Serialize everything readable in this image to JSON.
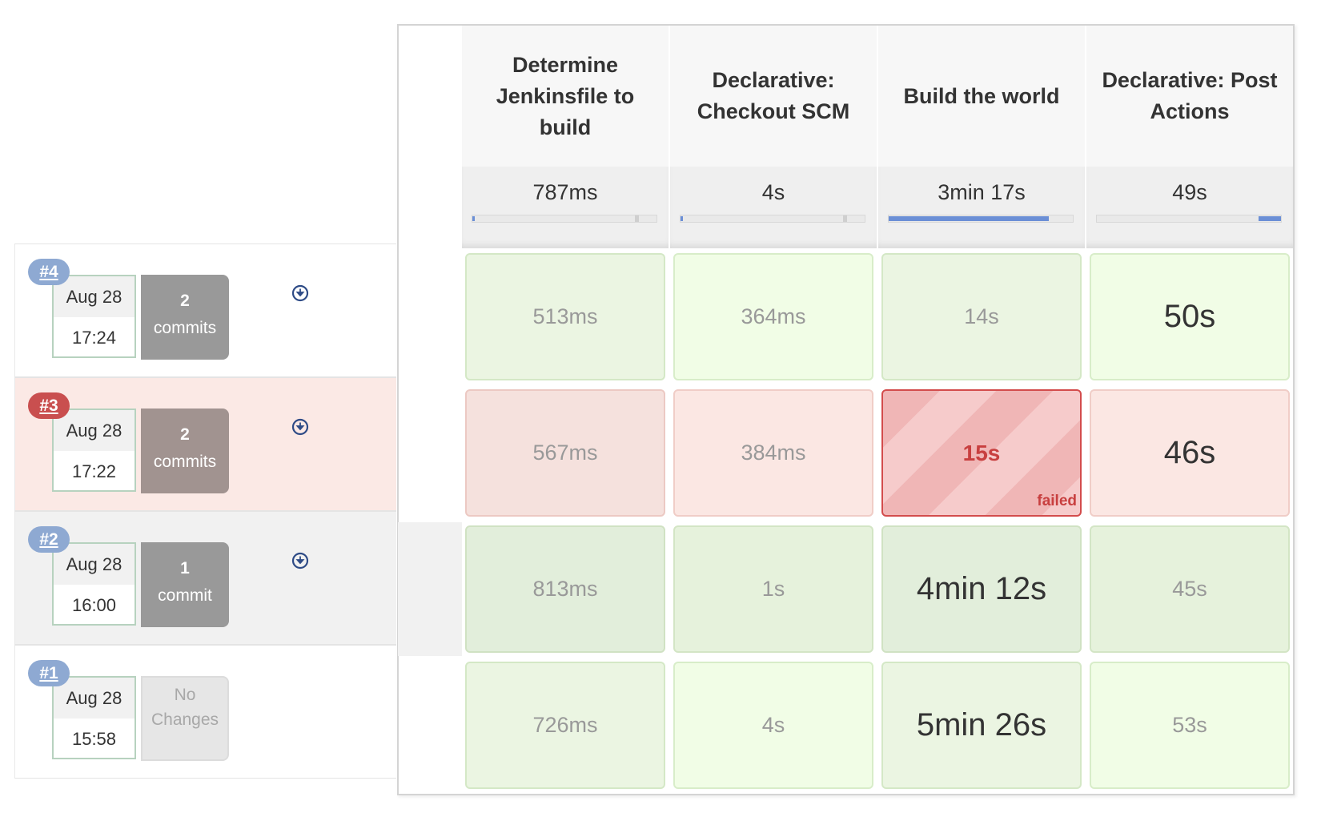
{
  "stages": [
    {
      "name": "Determine Jenkinsfile to build",
      "avg": "787ms",
      "bar": {
        "start": 0.0,
        "end": 0.01
      }
    },
    {
      "name": "Declarative: Checkout SCM",
      "avg": "4s",
      "bar": {
        "start": 0.0,
        "end": 0.01
      }
    },
    {
      "name": "Build the world",
      "avg": "3min 17s",
      "bar": {
        "start": 0.0,
        "end": 0.87
      }
    },
    {
      "name": "Declarative: Post Actions",
      "avg": "49s",
      "bar": {
        "start": 0.88,
        "end": 1.0
      }
    }
  ],
  "builds": [
    {
      "number": "#4",
      "status": "success",
      "date": "Aug 28",
      "time": "17:24",
      "changes_count": "2",
      "changes_label": "commits",
      "cells": [
        {
          "value": "513ms"
        },
        {
          "value": "364ms"
        },
        {
          "value": "14s"
        },
        {
          "value": "50s"
        }
      ]
    },
    {
      "number": "#3",
      "status": "failed",
      "date": "Aug 28",
      "time": "17:22",
      "changes_count": "2",
      "changes_label": "commits",
      "cells": [
        {
          "value": "567ms"
        },
        {
          "value": "384ms"
        },
        {
          "value": "15s",
          "state_label": "failed"
        },
        {
          "value": "46s"
        }
      ]
    },
    {
      "number": "#2",
      "status": "success",
      "date": "Aug 28",
      "time": "16:00",
      "changes_count": "1",
      "changes_label": "commit",
      "cells": [
        {
          "value": "813ms"
        },
        {
          "value": "1s"
        },
        {
          "value": "4min 12s"
        },
        {
          "value": "45s"
        }
      ]
    },
    {
      "number": "#1",
      "status": "success",
      "date": "Aug 28",
      "time": "15:58",
      "changes_count": "No",
      "changes_label": "Changes",
      "cells": [
        {
          "value": "726ms"
        },
        {
          "value": "4s"
        },
        {
          "value": "5min 26s"
        },
        {
          "value": "53s"
        }
      ]
    }
  ],
  "icons": {
    "download": "download-circle-icon"
  },
  "colors": {
    "success_cell": "#ebf5e2",
    "failed_cell": "#fbe7e3",
    "failed_border": "#d34c4c",
    "badge_blue": "#8ea9d2",
    "badge_red": "#c94f4f",
    "bar_fill": "#6b8fd6"
  }
}
